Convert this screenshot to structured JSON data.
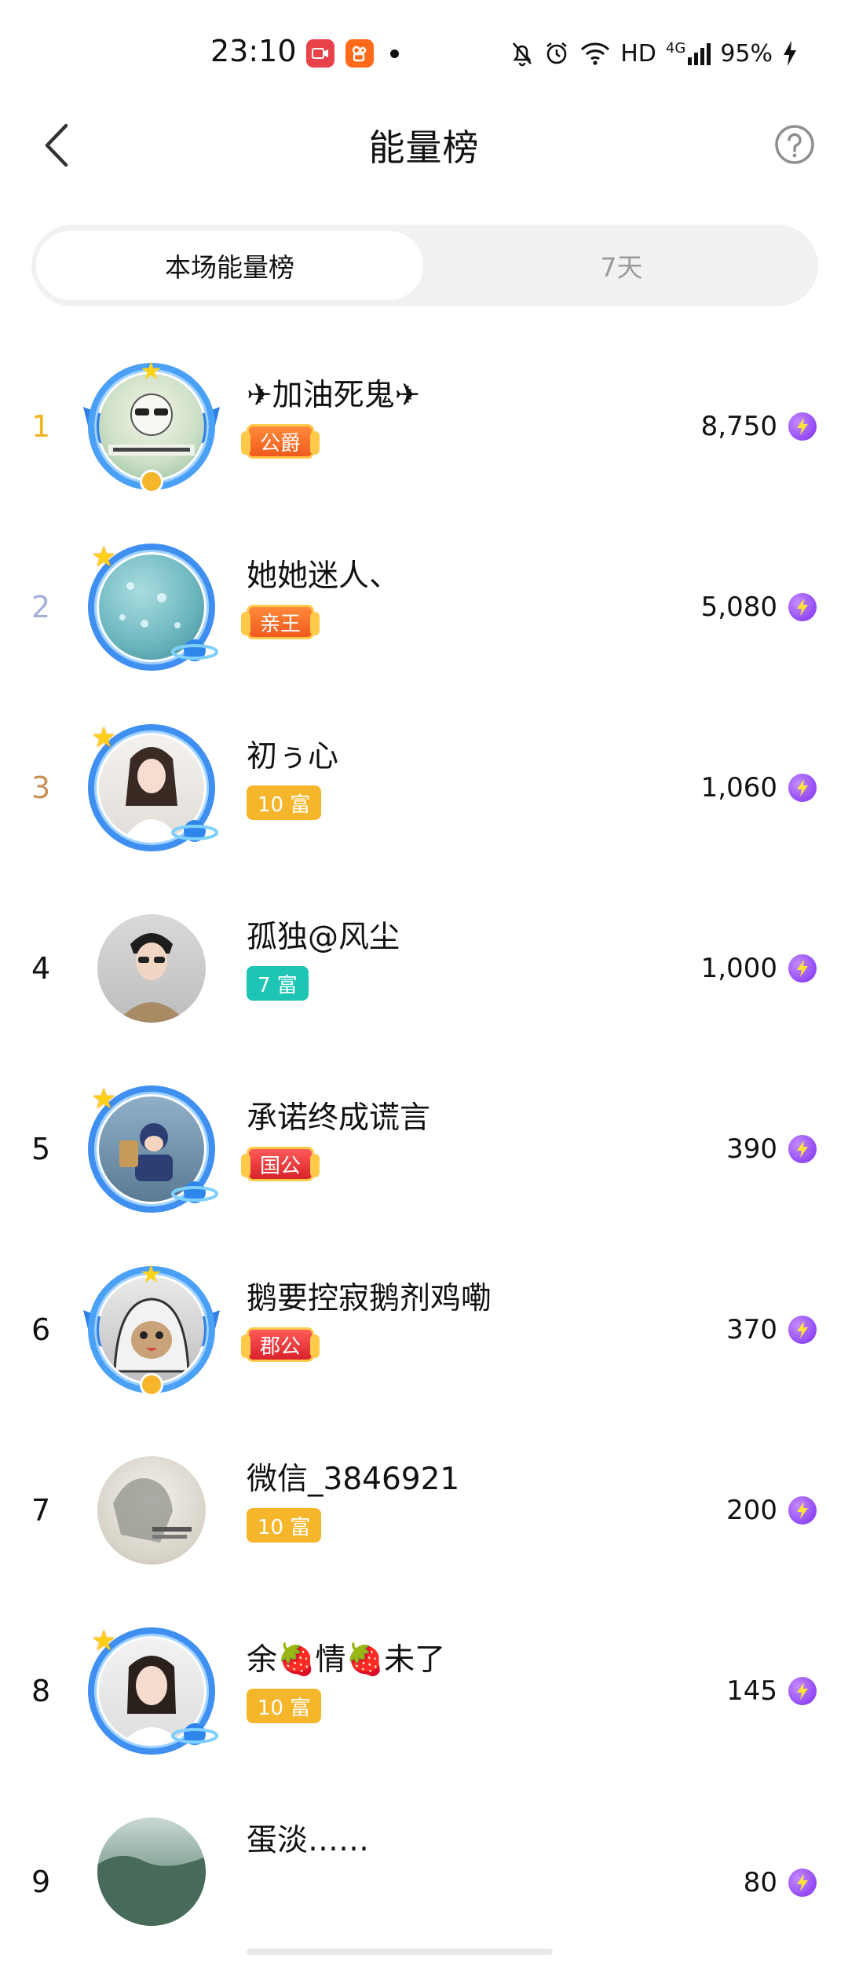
{
  "status_bar": {
    "time": "23:10",
    "network_label": "HD",
    "signal_label": "4G",
    "battery": "95%"
  },
  "header": {
    "title": "能量榜"
  },
  "tabs": [
    {
      "label": "本场能量榜",
      "active": true
    },
    {
      "label": "7天",
      "active": false
    }
  ],
  "ranking": [
    {
      "rank": "1",
      "name": "✈加油死鬼✈",
      "badge": "公爵",
      "badge_type": "noble-orange",
      "score": "8,750",
      "frame": "wings"
    },
    {
      "rank": "2",
      "name": "她她迷人、",
      "badge": "亲王",
      "badge_type": "noble-orange",
      "score": "5,080",
      "frame": "ring"
    },
    {
      "rank": "3",
      "name": "初ぅ心",
      "badge": "10 富",
      "badge_type": "rich",
      "score": "1,060",
      "frame": "ring"
    },
    {
      "rank": "4",
      "name": "孤独@风尘",
      "badge": "7 富",
      "badge_type": "rich7",
      "score": "1,000",
      "frame": "none"
    },
    {
      "rank": "5",
      "name": "承诺终成谎言",
      "badge": "国公",
      "badge_type": "noble-red",
      "score": "390",
      "frame": "ring"
    },
    {
      "rank": "6",
      "name": "鹅要控寂鹅剂鸡嘞",
      "badge": "郡公",
      "badge_type": "noble-red",
      "score": "370",
      "frame": "wings"
    },
    {
      "rank": "7",
      "name": "微信_3846921",
      "badge": "10 富",
      "badge_type": "rich",
      "score": "200",
      "frame": "none"
    },
    {
      "rank": "8",
      "name": "余🍓情🍓未了",
      "badge": "10 富",
      "badge_type": "rich",
      "score": "145",
      "frame": "ring"
    },
    {
      "rank": "9",
      "name": "蛋淡……",
      "badge": "",
      "badge_type": "",
      "score": "80",
      "frame": "none"
    }
  ],
  "icons": {
    "energy": "lightning-bolt-icon",
    "back": "chevron-left-icon",
    "help": "question-circle-icon"
  },
  "colors": {
    "rank_gold": "#f0b323",
    "rank_silver": "#a5b0d8",
    "rank_bronze": "#c99156",
    "energy_purple": "#7b2cf0",
    "rich_badge": "#f6b62c",
    "rich7_badge": "#1ec4b4"
  }
}
